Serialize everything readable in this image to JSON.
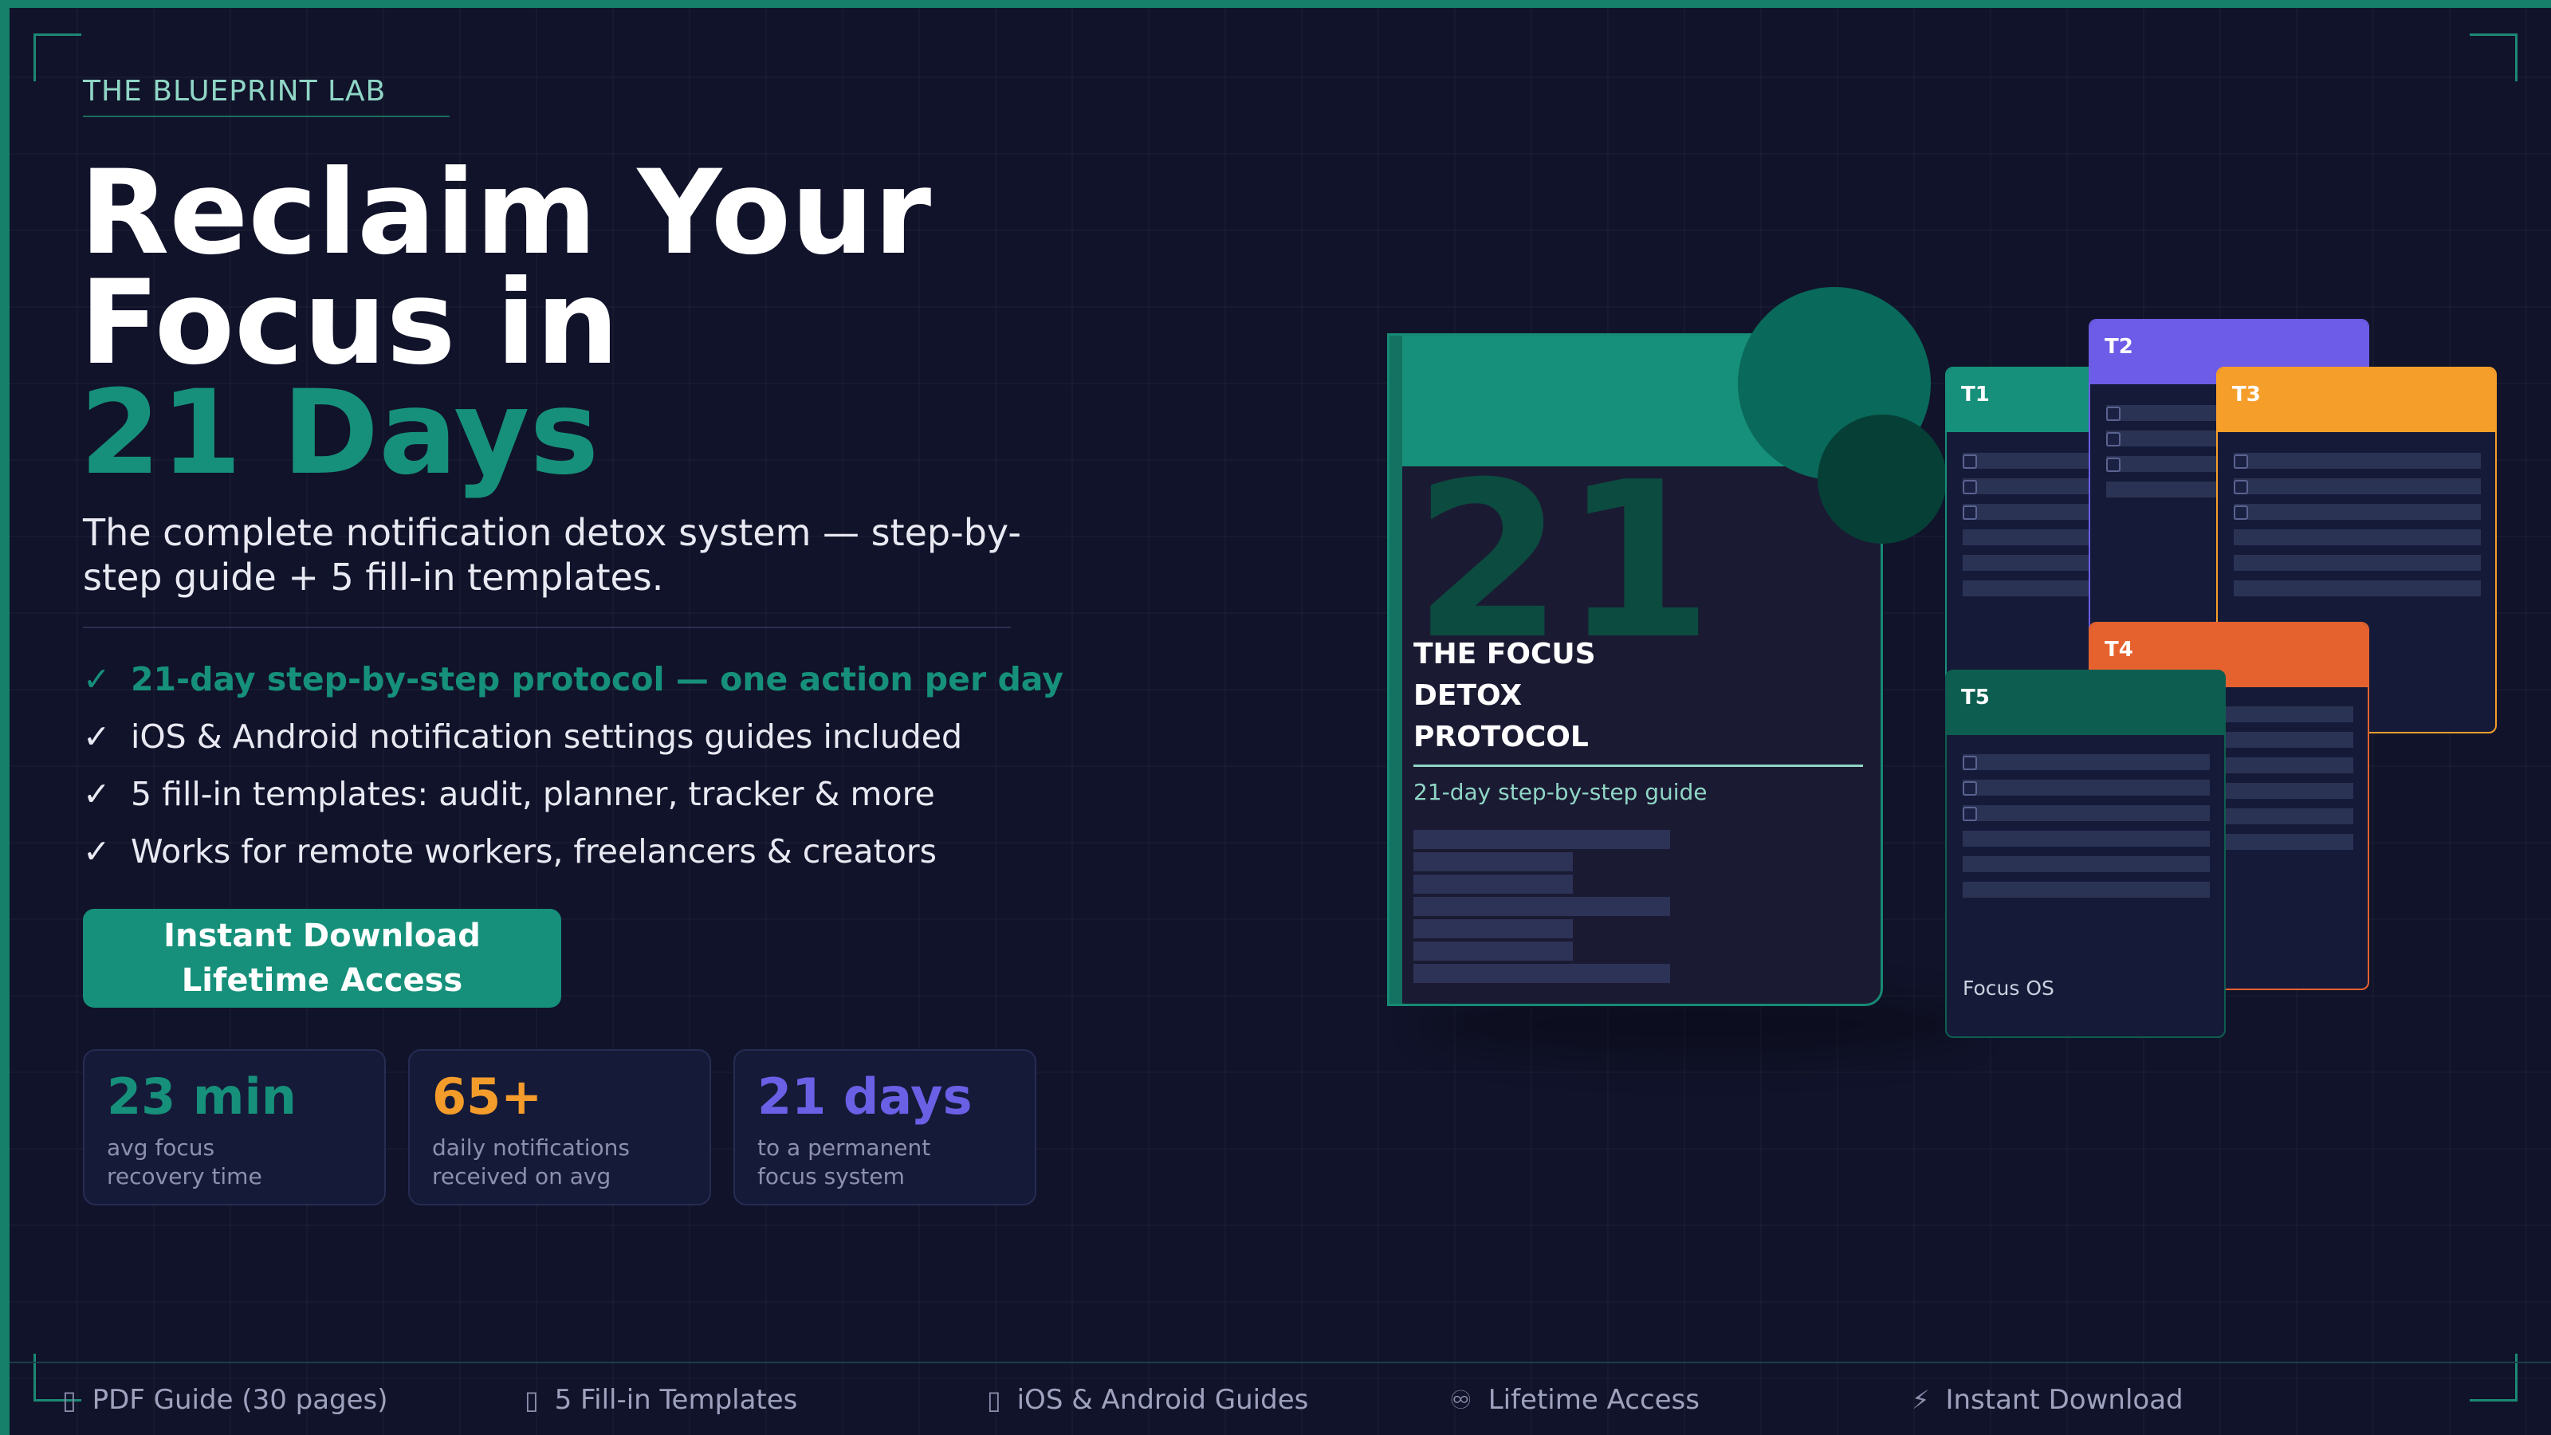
{
  "brand": "THE BLUEPRINT LAB",
  "headline": {
    "line1": "Reclaim Your",
    "line2": "Focus in",
    "accent": "21 Days"
  },
  "subhead": "The complete notification detox system — step-by-step guide + 5 fill-in templates.",
  "features": [
    {
      "check": "✓",
      "text": "21-day step-by-step protocol — one action per day"
    },
    {
      "check": "✓",
      "text": "iOS & Android notification settings guides included"
    },
    {
      "check": "✓",
      "text": "5 fill-in templates: audit, planner, tracker & more"
    },
    {
      "check": "✓",
      "text": "Works for remote workers, freelancers & creators"
    }
  ],
  "cta": {
    "line1": "Instant Download",
    "line2": "Lifetime Access"
  },
  "stats": [
    {
      "value": "23 min",
      "label_line1": "avg focus",
      "label_line2": "recovery time"
    },
    {
      "value": "65+",
      "label_line1": "daily notifications",
      "label_line2": "received on avg"
    },
    {
      "value": "21 days",
      "label_line1": "to a permanent",
      "label_line2": "focus system"
    }
  ],
  "book": {
    "number": "21",
    "title_line1": "THE FOCUS",
    "title_line2": "DETOX",
    "title_line3": "PROTOCOL",
    "subtitle": "21-day step-by-step guide"
  },
  "templates": [
    {
      "label": "T1",
      "color": "#16907a"
    },
    {
      "label": "T2",
      "color": "#6c5ce7"
    },
    {
      "label": "T3",
      "color": "#f59e2a"
    },
    {
      "label": "T4",
      "color": "#e5622f"
    },
    {
      "label": "T5",
      "color": "#0d5e50",
      "footer": "Focus OS"
    }
  ],
  "footer": [
    {
      "icon": "▯",
      "text": "PDF Guide (30 pages)"
    },
    {
      "icon": "▯",
      "text": "5 Fill-in Templates"
    },
    {
      "icon": "▯",
      "text": "iOS & Android Guides"
    },
    {
      "icon": "♾",
      "text": "Lifetime Access"
    },
    {
      "icon": "⚡",
      "text": "Instant Download"
    }
  ],
  "colors": {
    "background": "#11132a",
    "accent_green": "#16907a",
    "accent_orange": "#f39c2b",
    "accent_purple": "#6a60e6"
  }
}
